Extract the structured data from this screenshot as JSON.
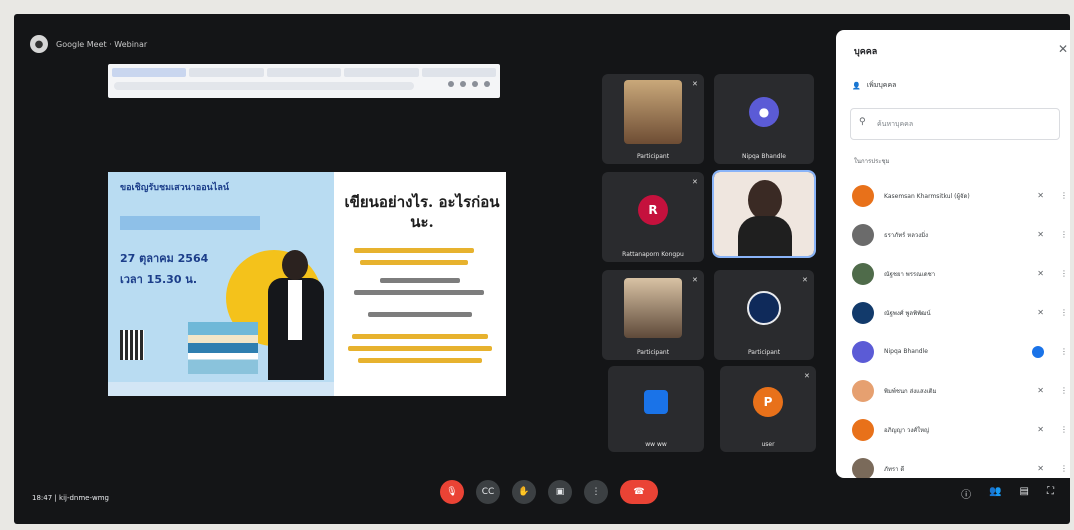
{
  "meeting": {
    "title": "Google Meet · Webinar",
    "time": "18:47",
    "code": "kij-dnme-wmg"
  },
  "slide": {
    "headline": "ขอเชิญรับชมเสวนาออนไลน์",
    "date": "27 ตุลาคม 2564",
    "time": "เวลา 15.30 น.",
    "right_title": "เขียนอย่างไร. อะไรก่อนนะ."
  },
  "participants_tiles": [
    {
      "name": "Participant",
      "initial": "",
      "avatar_color": ""
    },
    {
      "name": "Nipqa Bhandle",
      "initial": "",
      "avatar_color": "#5b5bd6"
    },
    {
      "name": "Rattanaporn Kongpu",
      "initial": "R",
      "avatar_color": "#c5113d"
    },
    {
      "name": "",
      "initial": "",
      "avatar_color": ""
    },
    {
      "name": "Participant",
      "initial": "",
      "avatar_color": ""
    },
    {
      "name": "Participant",
      "initial": "",
      "avatar_color": "#1a73e8"
    },
    {
      "name": "ww ww",
      "initial": "",
      "avatar_color": "#1a73e8"
    },
    {
      "name": "user",
      "initial": "P",
      "avatar_color": "#e8711a"
    }
  ],
  "panel": {
    "title": "บุคคล",
    "close_icon": "close-icon",
    "add_label": "เพิ่มบุคคล",
    "search_placeholder": "ค้นหาบุคคล",
    "section_label": "ในการประชุม",
    "people": [
      {
        "name": "Kasemsan Kharmsitkul (ผู้จัด)",
        "color": "#e8711a"
      },
      {
        "name": "ธราภัทร์ หลวงมิ่ง",
        "color": "#6b6b6b"
      },
      {
        "name": "ณัฐชยา พรรณเดชา",
        "color": "#4f6b4a"
      },
      {
        "name": "ณัฐพงศ์ พูลพิพัฒน์",
        "color": "#123a6b"
      },
      {
        "name": "Nipqa Bhandle",
        "color": "#5b5bd6"
      },
      {
        "name": "พิมพ์ชนก ส่งแสงเติม",
        "color": "#e6a070"
      },
      {
        "name": "อภิญญา วงศ์ใหญ่",
        "color": "#e8711a"
      },
      {
        "name": "ภัทรา ดี",
        "color": "#7a6a5a"
      }
    ]
  }
}
